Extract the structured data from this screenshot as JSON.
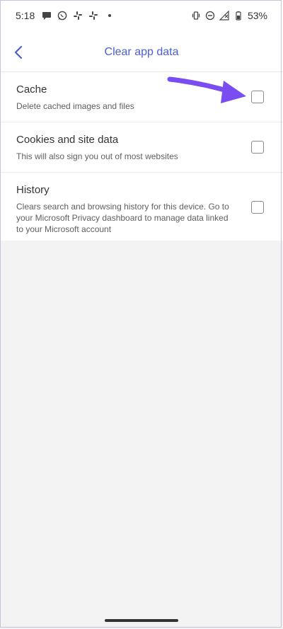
{
  "status_bar": {
    "time": "5:18",
    "battery": "53%",
    "icons_left": [
      "message-icon",
      "whatsapp-icon",
      "slack-icon",
      "slack-icon",
      "dot"
    ],
    "icons_right": [
      "vibrate-icon",
      "dnd-icon",
      "signal-icon",
      "battery-icon"
    ]
  },
  "header": {
    "title": "Clear app data",
    "back_icon": "chevron-left-icon",
    "accent": "#4a5fd1"
  },
  "options": [
    {
      "title": "Cache",
      "description": "Delete cached images and files",
      "checked": false
    },
    {
      "title": "Cookies and site data",
      "description": "This will also sign you out of most websites",
      "checked": false
    },
    {
      "title": "History",
      "description": "Clears search and browsing history for this device. Go to your Microsoft Privacy dashboard to manage data linked to your Microsoft account",
      "checked": false
    }
  ],
  "annotation": {
    "arrow_color": "#7a4df0",
    "points_to": "Cache checkbox"
  }
}
